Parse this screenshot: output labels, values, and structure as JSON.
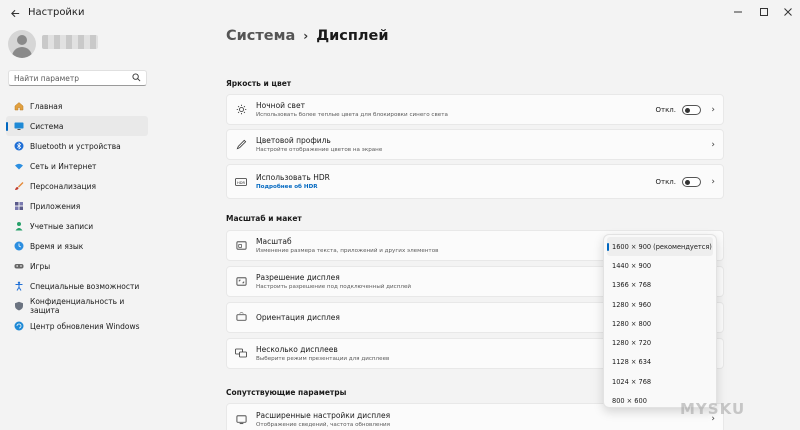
{
  "app": {
    "title": "Настройки"
  },
  "search": {
    "placeholder": "Найти параметр"
  },
  "sidebar": {
    "items": [
      {
        "label": "Главная"
      },
      {
        "label": "Система"
      },
      {
        "label": "Bluetooth и устройства"
      },
      {
        "label": "Сеть и Интернет"
      },
      {
        "label": "Персонализация"
      },
      {
        "label": "Приложения"
      },
      {
        "label": "Учетные записи"
      },
      {
        "label": "Время и язык"
      },
      {
        "label": "Игры"
      },
      {
        "label": "Специальные возможности"
      },
      {
        "label": "Конфиденциальность и защита"
      },
      {
        "label": "Центр обновления Windows"
      }
    ]
  },
  "breadcrumb": {
    "root": "Система",
    "current": "Дисплей"
  },
  "sections": {
    "brightness": "Яркость и цвет",
    "scale": "Масштаб и макет",
    "related": "Сопутствующие параметры"
  },
  "cards": {
    "night_light": {
      "title": "Ночной свет",
      "subtitle": "Использовать более теплые цвета для блокировки синего света",
      "toggle": "Откл."
    },
    "color_profile": {
      "title": "Цветовой профиль",
      "subtitle": "Настройте отображение цветов на экране"
    },
    "hdr": {
      "title": "Использовать HDR",
      "link": "Подробнее об HDR",
      "toggle": "Откл."
    },
    "scale": {
      "title": "Масштаб",
      "subtitle": "Изменение размера текста, приложений и других элементов"
    },
    "resolution": {
      "title": "Разрешение дисплея",
      "subtitle": "Настроить разрешение под подключенный дисплей"
    },
    "orientation": {
      "title": "Ориентация дисплея"
    },
    "multi": {
      "title": "Несколько дисплеев",
      "subtitle": "Выберите режим презентации для дисплеев"
    },
    "advanced": {
      "title": "Расширенные настройки дисплея",
      "subtitle": "Отображение сведений, частота обновления"
    }
  },
  "resolution_options": [
    "1600 × 900 (рекомендуется)",
    "1440 × 900",
    "1366 × 768",
    "1280 × 960",
    "1280 × 800",
    "1280 × 720",
    "1128 × 634",
    "1024 × 768",
    "800 × 600"
  ],
  "watermark": "MYSKU",
  "colors": {
    "accent": "#0067c0",
    "background": "#f3f3f3",
    "card": "#fbfbfb"
  }
}
